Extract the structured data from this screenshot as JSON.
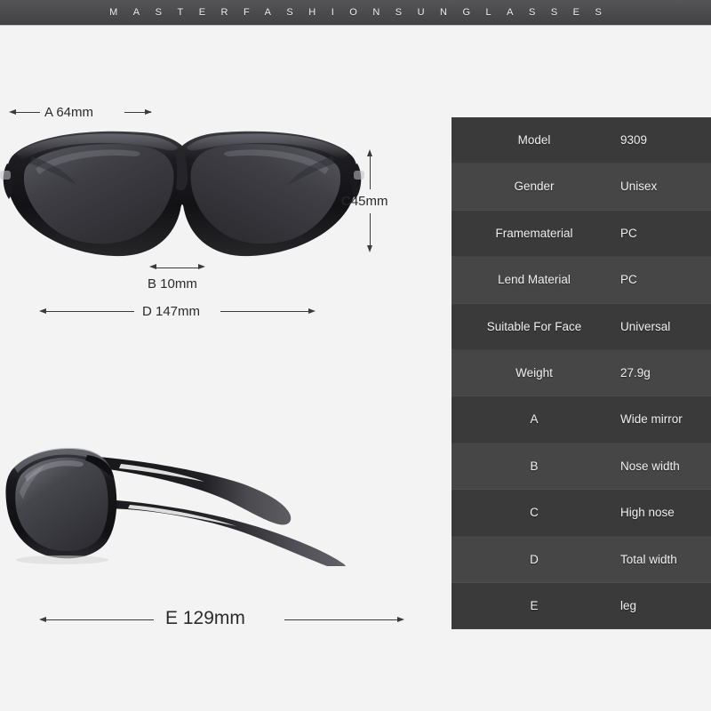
{
  "banner": {
    "brand_text": "MASTERFASHIONSUNGLASSES"
  },
  "spec_table": {
    "rows": [
      {
        "label": "Model",
        "value": "9309"
      },
      {
        "label": "Gender",
        "value": "Unisex"
      },
      {
        "label": "Framematerial",
        "value": "PC"
      },
      {
        "label": "Lend Material",
        "value": "PC"
      },
      {
        "label": "Suitable For Face",
        "value": "Universal"
      },
      {
        "label": "Weight",
        "value": "27.9g"
      },
      {
        "label": "A",
        "value": "Wide mirror"
      },
      {
        "label": "B",
        "value": "Nose width"
      },
      {
        "label": "C",
        "value": "High nose"
      },
      {
        "label": "D",
        "value": "Total width"
      },
      {
        "label": "E",
        "value": "leg"
      }
    ]
  },
  "dimensions": {
    "a": "A 64mm",
    "b": "B 10mm",
    "c": "C45mm",
    "d": "D 147mm",
    "e": "E 129mm"
  },
  "colors": {
    "background": "#f3f3f3",
    "banner": "#4a4a4c",
    "table_row_dark": "#3a3a3a",
    "table_row_light": "#464646",
    "table_text": "#f0f0f0",
    "dimension_line": "#3a3a3a",
    "frame_black": "#17171a",
    "lens_gray": "#3d3d42",
    "temple_tip_gray": "#5a5a5c"
  }
}
